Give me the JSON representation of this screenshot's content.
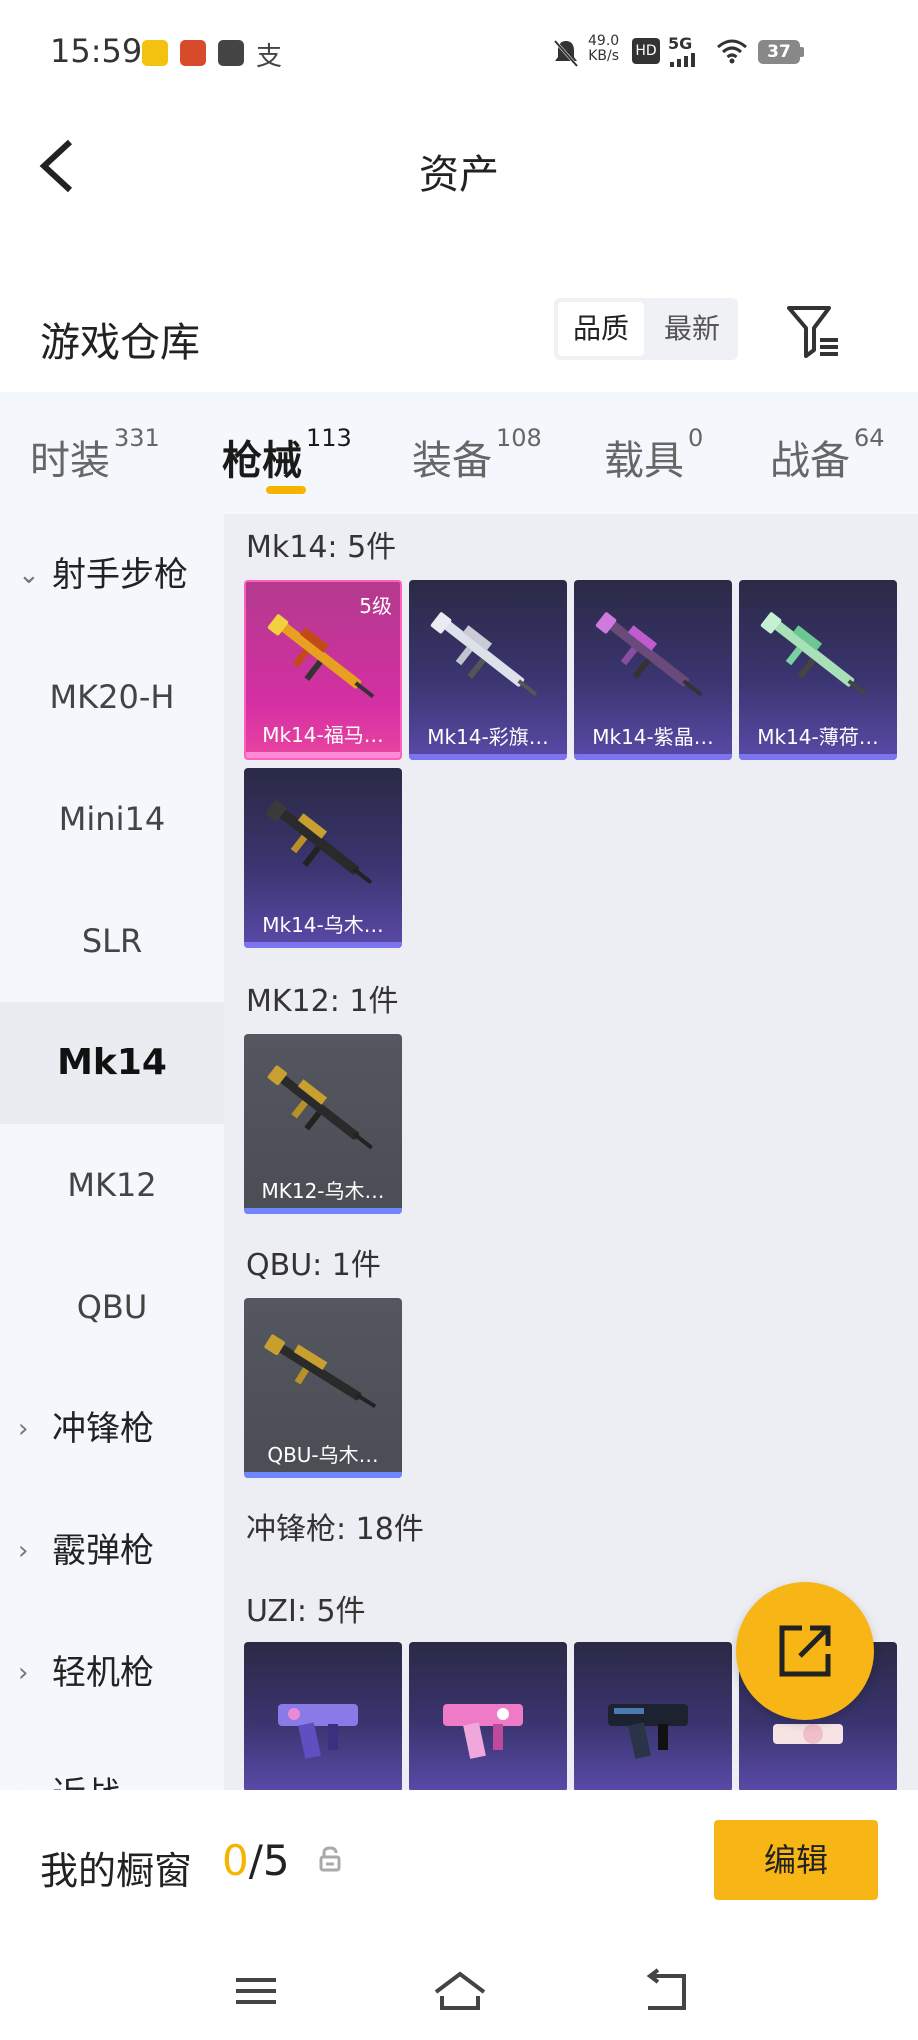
{
  "status_bar": {
    "time": "15:59",
    "net_speed": "49.0",
    "net_unit": "KB/s",
    "hd": "HD",
    "signal": "5G",
    "battery": "37"
  },
  "header": {
    "title": "资产"
  },
  "warehouse": {
    "title": "游戏仓库",
    "sort_quality": "品质",
    "sort_newest": "最新"
  },
  "tabs": [
    {
      "label": "时装",
      "count": "331"
    },
    {
      "label": "枪械",
      "count": "113"
    },
    {
      "label": "装备",
      "count": "108"
    },
    {
      "label": "载具",
      "count": "0"
    },
    {
      "label": "战备",
      "count": "64"
    }
  ],
  "sidebar": [
    {
      "label": "射手步枪",
      "chevron": "⌄"
    },
    {
      "label": "MK20-H"
    },
    {
      "label": "Mini14"
    },
    {
      "label": "SLR"
    },
    {
      "label": "Mk14"
    },
    {
      "label": "MK12"
    },
    {
      "label": "QBU"
    },
    {
      "label": "冲锋枪",
      "chevron": "›"
    },
    {
      "label": "霰弹枪",
      "chevron": "›"
    },
    {
      "label": "轻机枪",
      "chevron": "›"
    },
    {
      "label": "近战",
      "chevron": "›"
    }
  ],
  "sections": [
    {
      "title": "Mk14: 5件"
    },
    {
      "title": "MK12: 1件"
    },
    {
      "title": "QBU: 1件"
    },
    {
      "title": "冲锋枪: 18件"
    },
    {
      "title": "UZI: 5件"
    }
  ],
  "items": [
    {
      "name": "Mk14-福马…",
      "level": "5级",
      "rarity": "pink"
    },
    {
      "name": "Mk14-彩旗…",
      "rarity": "purple"
    },
    {
      "name": "Mk14-紫晶…",
      "rarity": "purple"
    },
    {
      "name": "Mk14-薄荷…",
      "rarity": "purple"
    },
    {
      "name": "Mk14-乌木…",
      "rarity": "purple"
    },
    {
      "name": "MK12-乌木…",
      "rarity": "gray"
    },
    {
      "name": "QBU-乌木…",
      "rarity": "gray"
    }
  ],
  "showcase": {
    "title": "我的橱窗",
    "used": "0",
    "slash_total": "/5",
    "edit_label": "编辑"
  }
}
